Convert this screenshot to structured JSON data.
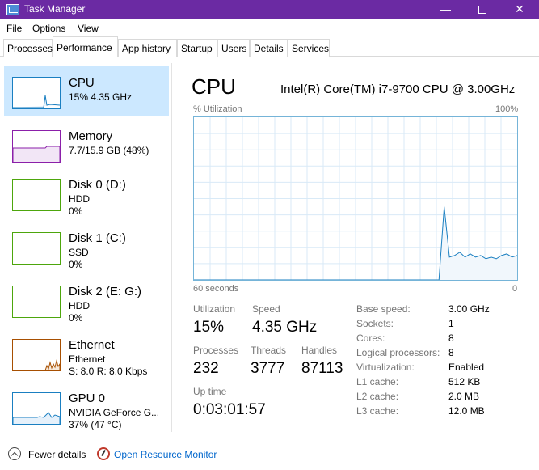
{
  "window": {
    "title": "Task Manager"
  },
  "window_controls": {
    "minimize": "—",
    "close": "✕"
  },
  "menu": [
    "File",
    "Options",
    "View"
  ],
  "tabs": [
    "Processes",
    "Performance",
    "App history",
    "Startup",
    "Users",
    "Details",
    "Services"
  ],
  "active_tab": "Performance",
  "sidebar": [
    {
      "name": "CPU",
      "line1": "15%  4.35 GHz",
      "line2": "",
      "color": "#1a7fc1",
      "active": true
    },
    {
      "name": "Memory",
      "line1": "7.7/15.9 GB (48%)",
      "line2": "",
      "color": "#8b1fa9",
      "active": false
    },
    {
      "name": "Disk 0 (D:)",
      "line1": "HDD",
      "line2": "0%",
      "color": "#4da60c",
      "active": false
    },
    {
      "name": "Disk 1 (C:)",
      "line1": "SSD",
      "line2": "0%",
      "color": "#4da60c",
      "active": false
    },
    {
      "name": "Disk 2 (E: G:)",
      "line1": "HDD",
      "line2": "0%",
      "color": "#4da60c",
      "active": false
    },
    {
      "name": "Ethernet",
      "line1": "Ethernet",
      "line2": "S: 8.0  R: 8.0 Kbps",
      "color": "#a74f01",
      "active": false
    },
    {
      "name": "GPU 0",
      "line1": "NVIDIA GeForce G...",
      "line2": "37%  (47 °C)",
      "color": "#1a7fc1",
      "active": false
    }
  ],
  "main": {
    "title": "CPU",
    "model": "Intel(R) Core(TM) i7-9700 CPU @ 3.00GHz",
    "y_axis_label": "% Utilization",
    "y_axis_max": "100%",
    "x_axis_left": "60 seconds",
    "x_axis_right": "0",
    "graph_color": "#1a7fc1",
    "utilization_history": [
      0,
      0,
      0,
      0,
      0,
      0,
      0,
      0,
      0,
      0,
      0,
      0,
      0,
      0,
      0,
      0,
      0,
      0,
      0,
      0,
      0,
      0,
      0,
      0,
      0,
      0,
      0,
      0,
      0,
      0,
      0,
      0,
      0,
      0,
      0,
      0,
      0,
      0,
      0,
      0,
      0,
      0,
      0,
      0,
      0,
      0,
      0,
      0,
      45,
      14,
      15,
      17,
      14,
      16,
      14,
      15,
      13,
      14,
      13,
      15,
      16,
      14,
      15
    ]
  },
  "stats": {
    "utilization_label": "Utilization",
    "utilization": "15%",
    "speed_label": "Speed",
    "speed": "4.35 GHz",
    "processes_label": "Processes",
    "processes": "232",
    "threads_label": "Threads",
    "threads": "3777",
    "handles_label": "Handles",
    "handles": "87113",
    "uptime_label": "Up time",
    "uptime": "0:03:01:57"
  },
  "specs": [
    {
      "label": "Base speed:",
      "value": "3.00 GHz"
    },
    {
      "label": "Sockets:",
      "value": "1"
    },
    {
      "label": "Cores:",
      "value": "8"
    },
    {
      "label": "Logical processors:",
      "value": "8"
    },
    {
      "label": "Virtualization:",
      "value": "Enabled"
    },
    {
      "label": "L1 cache:",
      "value": "512 KB"
    },
    {
      "label": "L2 cache:",
      "value": "2.0 MB"
    },
    {
      "label": "L3 cache:",
      "value": "12.0 MB"
    }
  ],
  "footer": {
    "fewer_details": "Fewer details",
    "resource_monitor": "Open Resource Monitor"
  }
}
